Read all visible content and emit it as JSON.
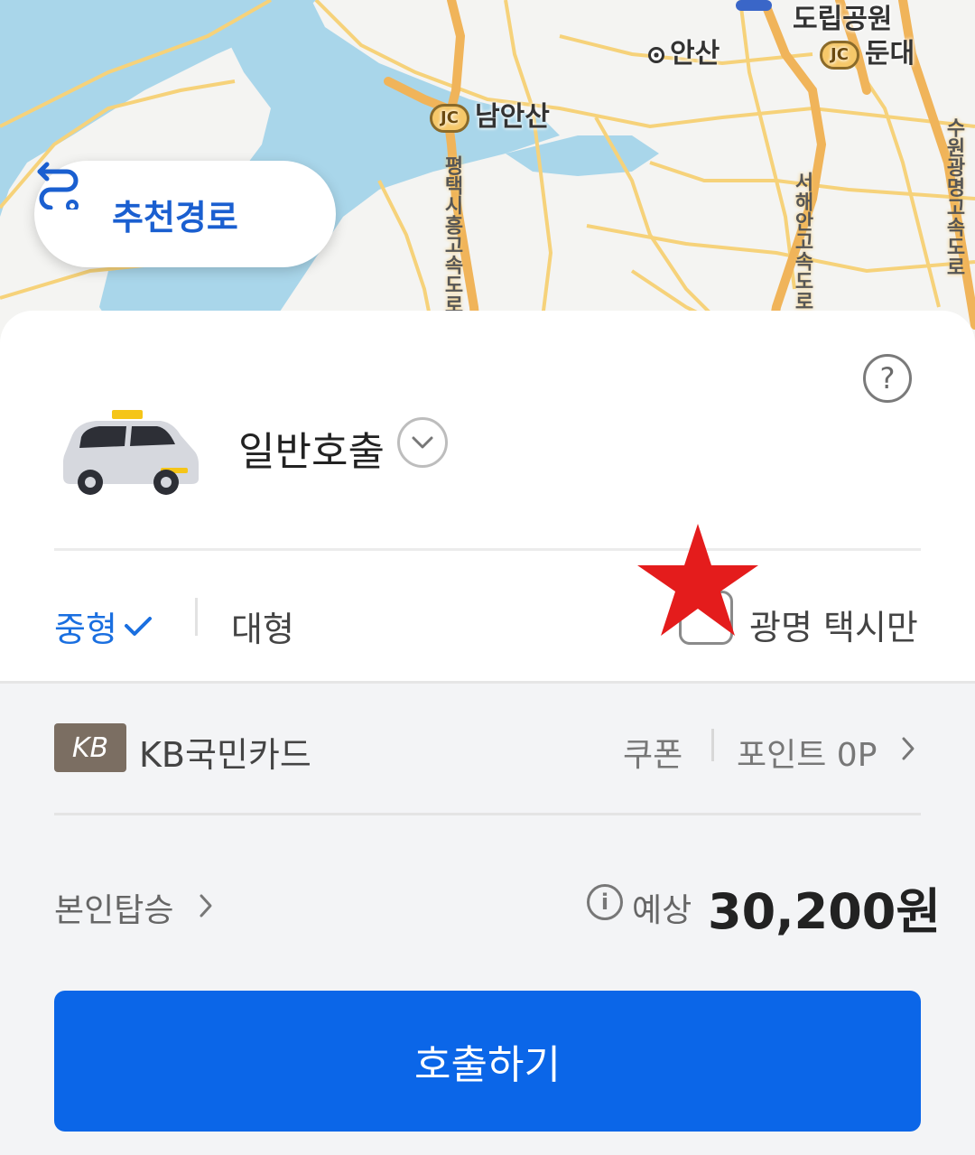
{
  "map": {
    "labels": {
      "doripgongwon": "도립공원",
      "ansan": "안산",
      "dundae": "둔대",
      "namansan": "남안산",
      "jc": "JC",
      "road_pyeongtaek": "평택시흥고속도로",
      "road_seohaean": "서해안고속도로",
      "road_suwon": "수원광명고속도로"
    },
    "colors": {
      "water": "#a9d6ea",
      "road": "#f6c86a",
      "land": "#f4f4f2"
    }
  },
  "route_button": {
    "label": "추천경로",
    "icon": "route-icon"
  },
  "sheet": {
    "help_icon": "question-icon",
    "mode": {
      "label": "일반호출",
      "icon": "taxi-icon"
    },
    "sizes": {
      "medium": "중형",
      "large": "대형",
      "selected": "medium"
    },
    "only_option": {
      "label": "광명 택시만",
      "checked": false
    },
    "payment": {
      "card_logo": "KB",
      "card_name": "KB국민카드",
      "coupon": "쿠폰",
      "points": "포인트 0P"
    },
    "self_boarding": "본인탑승",
    "estimate": {
      "label": "예상",
      "price": "30,200원"
    },
    "call_button": "호출하기"
  },
  "colors": {
    "accent": "#0b66e8",
    "selected_text": "#1a6fe0",
    "star": "#e41c1c"
  }
}
